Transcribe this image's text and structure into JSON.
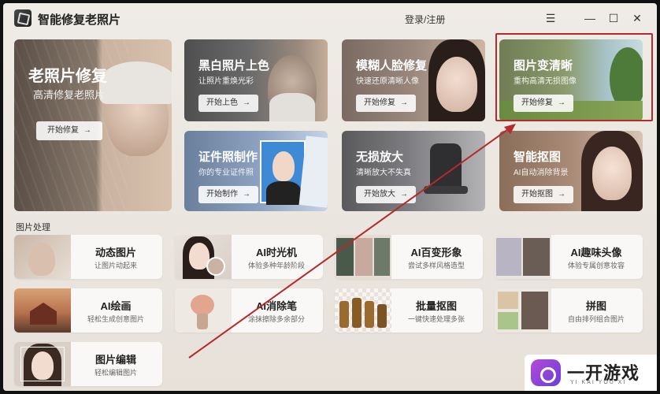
{
  "app": {
    "title": "智能修复老照片",
    "login": "登录/注册"
  },
  "window_controls": {
    "menu": "☰",
    "minimize": "—",
    "maximize": "☐",
    "close": "✕"
  },
  "features": [
    {
      "title": "老照片修复",
      "subtitle": "高清修复老照片",
      "button": "开始修复"
    },
    {
      "title": "黑白照片上色",
      "subtitle": "让照片重焕光彩",
      "button": "开始上色"
    },
    {
      "title": "模糊人脸修复",
      "subtitle": "快速还原清晰人像",
      "button": "开始修复"
    },
    {
      "title": "图片变清晰",
      "subtitle": "重构高清无损图像",
      "button": "开始修复"
    },
    {
      "title": "证件照制作",
      "subtitle": "你的专业证件照",
      "button": "开始制作"
    },
    {
      "title": "无损放大",
      "subtitle": "清晰放大不失真",
      "button": "开始放大"
    },
    {
      "title": "智能抠图",
      "subtitle": "AI自动消除背景",
      "button": "开始抠图"
    }
  ],
  "section_label": "图片处理",
  "tools": [
    {
      "title": "动态图片",
      "subtitle": "让图片动起来"
    },
    {
      "title": "AI时光机",
      "subtitle": "体验多种年龄阶段"
    },
    {
      "title": "AI百变形象",
      "subtitle": "尝试多样风格造型"
    },
    {
      "title": "AI趣味头像",
      "subtitle": "体验专属创意妆容"
    },
    {
      "title": "AI绘画",
      "subtitle": "轻松生成创意图片"
    },
    {
      "title": "AI消除笔",
      "subtitle": "涂抹擦除多余部分"
    },
    {
      "title": "批量抠图",
      "subtitle": "一键快速处理多张"
    },
    {
      "title": "拼图",
      "subtitle": "自由排列组合图片"
    },
    {
      "title": "图片编辑",
      "subtitle": "轻松编辑图片"
    }
  ],
  "watermark": {
    "text": "一开游戏",
    "sub": "YI KAI YOU XI"
  },
  "colors": {
    "highlight": "#b52a2a"
  }
}
